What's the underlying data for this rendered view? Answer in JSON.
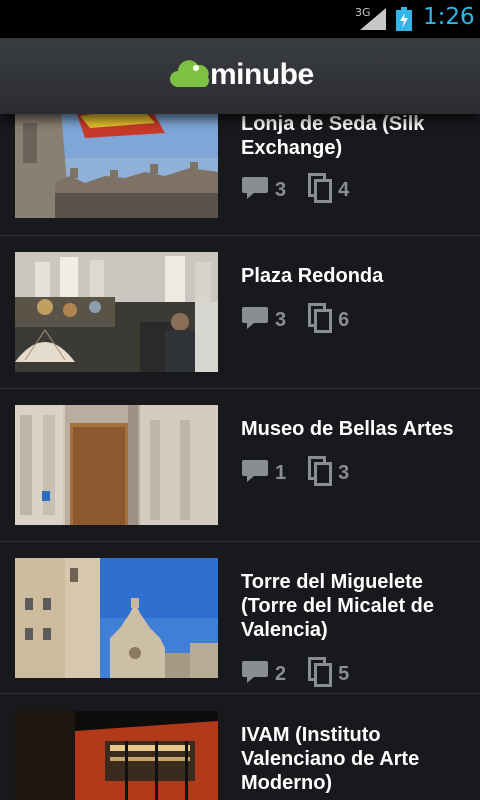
{
  "status": {
    "network": "3G",
    "time": "1:26"
  },
  "header": {
    "logo_text": "minube"
  },
  "places": [
    {
      "title": "Lonja de Seda (Silk Exchange)",
      "comments": "3",
      "photos": "4",
      "image": "gothic-facade-with-flags"
    },
    {
      "title": "Plaza Redonda",
      "comments": "3",
      "photos": "6",
      "image": "market-stall-with-fans"
    },
    {
      "title": "Museo de Bellas Artes",
      "comments": "1",
      "photos": "3",
      "image": "stone-doorway"
    },
    {
      "title": "Torre del Miguelete (Torre del Micalet de Valencia)",
      "comments": "2",
      "photos": "5",
      "image": "cathedral-tower-blue-sky"
    },
    {
      "title": "IVAM (Instituto Valenciano de Arte Moderno)",
      "comments": "",
      "photos": "",
      "image": "modern-building-at-night"
    }
  ],
  "icons": {
    "comments": "speech-bubble-icon",
    "photos": "photo-stack-icon"
  },
  "colors": {
    "accent_clock": "#33b5e5",
    "stat_gray": "#8a8d91",
    "logo_green": "#7dc142"
  }
}
